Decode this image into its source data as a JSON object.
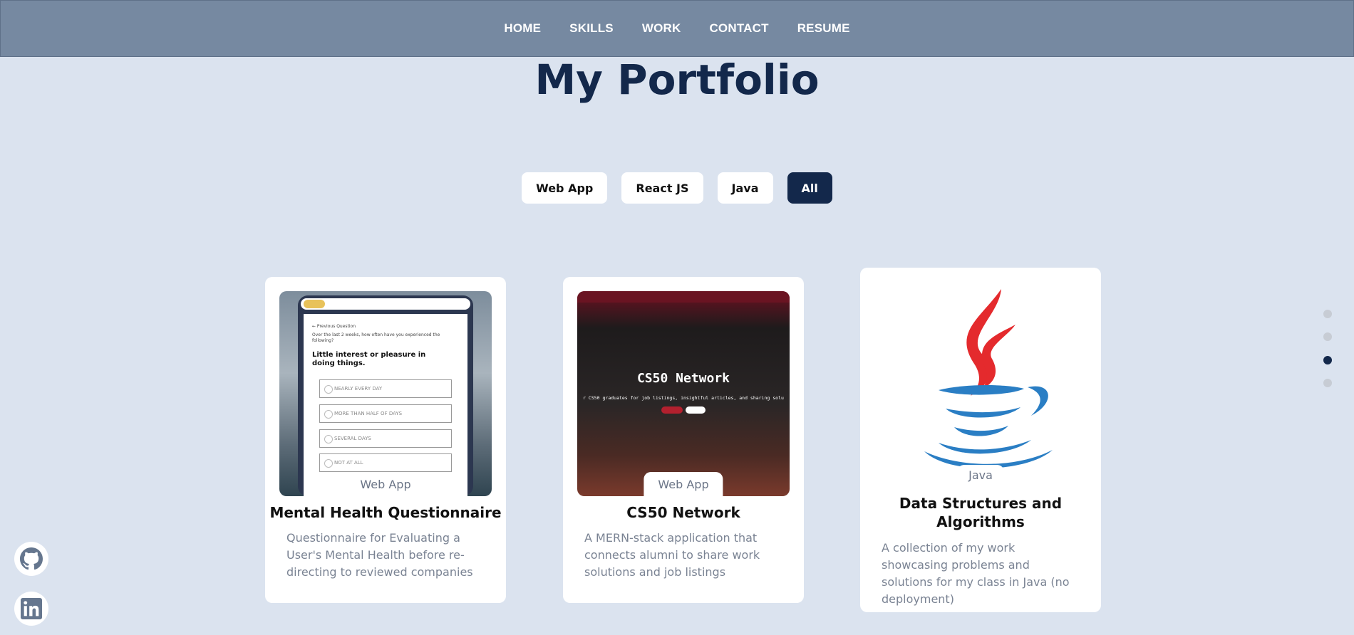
{
  "nav": {
    "items": [
      "HOME",
      "SKILLS",
      "WORK",
      "CONTACT",
      "RESUME"
    ]
  },
  "page_title": "My Portfolio",
  "filters": [
    "Web App",
    "React JS",
    "Java",
    "All"
  ],
  "active_filter": "All",
  "cards": [
    {
      "tag": "Web App",
      "title": "Mental Health Questionnaire",
      "description": "Questionnaire for Evaluating a User's Mental Health before re-directing to reviewed companies",
      "preview": {
        "back_link": "← Previous Question",
        "prompt": "Over the last 2 weeks, how often have you experienced the following?",
        "question": "Little interest or pleasure in doing things.",
        "options": [
          "NEARLY EVERY DAY",
          "MORE THAN HALF OF DAYS",
          "SEVERAL DAYS",
          "NOT AT ALL"
        ]
      }
    },
    {
      "tag": "Web App",
      "title": "CS50 Network",
      "description": "A MERN-stack application that connects alumni to share work solutions and job listings",
      "preview": {
        "title": "CS50 Network",
        "subtitle": "r CS50 graduates for job listings, insightful articles, and sharing solu"
      }
    },
    {
      "tag": "Java",
      "title": "Data Structures and Algorithms",
      "description": "A collection of my work showcasing problems and solutions for my class in Java (no deployment)"
    }
  ],
  "colors": {
    "background": "#dbe3ef",
    "navbar": "#7689a1",
    "primary": "#13284b",
    "java_red": "#e42a2d",
    "java_blue": "#2a7ec4"
  },
  "section_dots": {
    "count": 4,
    "active_index": 2
  },
  "social": [
    "github-icon",
    "linkedin-icon"
  ]
}
